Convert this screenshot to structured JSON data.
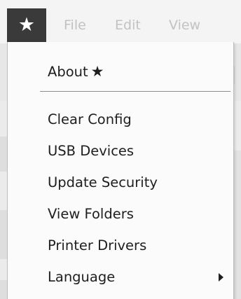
{
  "menubar": {
    "star_glyph": "★",
    "items": [
      {
        "label": "File"
      },
      {
        "label": "Edit"
      },
      {
        "label": "View"
      }
    ]
  },
  "background": {
    "ruler_unit": "mm"
  },
  "dropdown": {
    "about_label": "About",
    "about_star": "★",
    "items": [
      {
        "label": "Clear Config"
      },
      {
        "label": "USB Devices"
      },
      {
        "label": "Update Security"
      },
      {
        "label": "View Folders"
      },
      {
        "label": "Printer Drivers"
      },
      {
        "label": "Language",
        "has_submenu": true
      }
    ]
  },
  "colors": {
    "menu_button_bg": "#3a3a3a",
    "menubar_text_disabled": "#c2c2c2",
    "menu_bg": "#fbfbfb",
    "menu_text": "#1e1e1e"
  }
}
